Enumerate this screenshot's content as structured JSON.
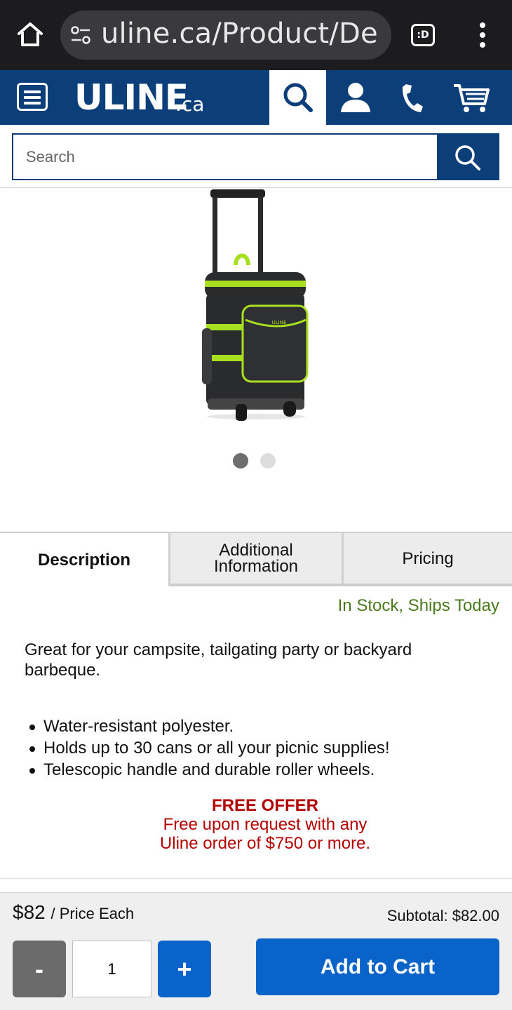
{
  "browser": {
    "url": "uline.ca/Product/De",
    "tabs_badge": ":D",
    "icons": [
      "home-icon",
      "site-settings-icon",
      "tabs-icon",
      "more-vert-icon"
    ]
  },
  "header": {
    "logo": "ULINE",
    "logo_suffix": ".ca",
    "icons": [
      "menu-icon",
      "search-icon",
      "account-icon",
      "phone-icon",
      "cart-icon"
    ],
    "brand_color": "#0c3f7a"
  },
  "search": {
    "placeholder": "Search"
  },
  "gallery": {
    "product_logo": "ULINE",
    "slide_count": 2,
    "active_slide": 1,
    "colors": {
      "active_dot": "#6e6e6e",
      "inactive_dot": "#dddddd",
      "trim": "#a8e021",
      "body": "#2a2b2d"
    }
  },
  "tabs": [
    {
      "label": "Description",
      "active": true
    },
    {
      "label": "Additional\nInformation",
      "active": false
    },
    {
      "label": "Pricing",
      "active": false
    }
  ],
  "stock_status": "In Stock, Ships Today",
  "description": "Great for your campsite, tailgating party or backyard barbeque.",
  "features": [
    "Water-resistant polyester.",
    "Holds up to 30 cans or all your picnic supplies!",
    "Telescopic handle and durable roller wheels."
  ],
  "offer": {
    "title": "FREE OFFER",
    "line1": "Free upon request with any",
    "line2": "Uline order of $750 or more."
  },
  "buy": {
    "price": "$82",
    "price_unit": "/ Price Each",
    "subtotal": "Subtotal: $82.00",
    "minus_label": "-",
    "quantity": "1",
    "plus_label": "+",
    "add_to_cart": "Add to Cart",
    "colors": {
      "primary": "#0a63c9",
      "minus": "#6b6b6b"
    }
  }
}
